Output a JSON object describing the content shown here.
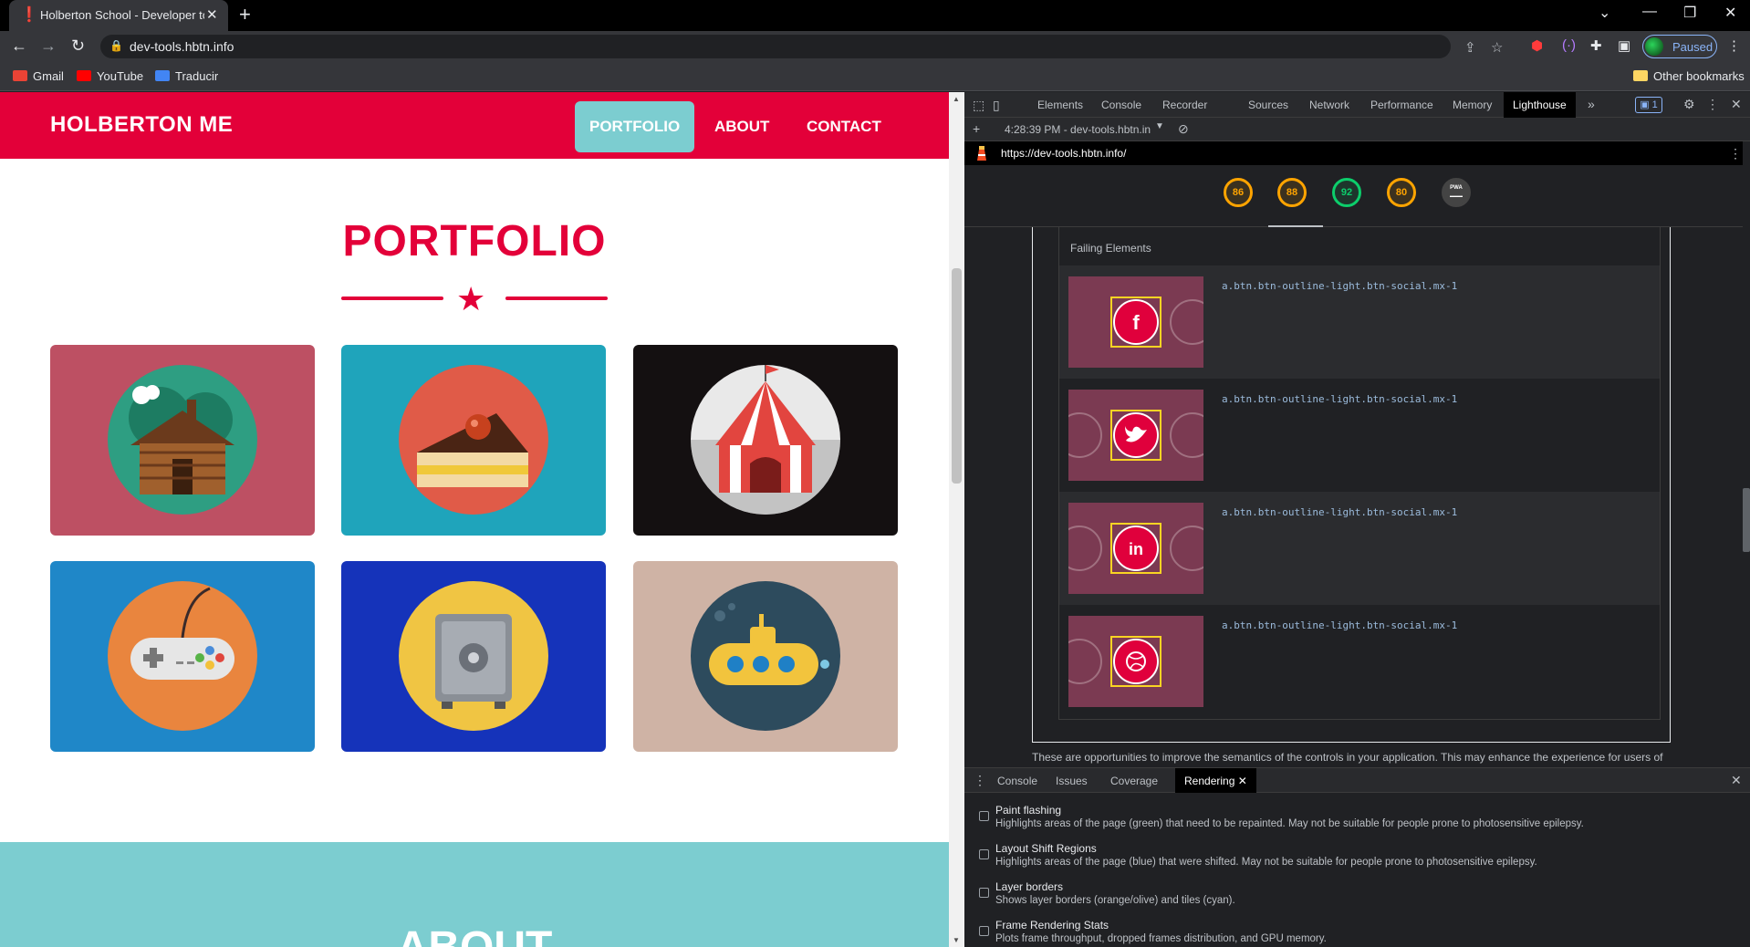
{
  "browser": {
    "tab_title": "Holberton School - Developer to",
    "url": "dev-tools.hbtn.info",
    "profile_status": "Paused",
    "bookmarks": [
      "Gmail",
      "YouTube",
      "Traducir"
    ],
    "other_bookmarks": "Other bookmarks"
  },
  "site": {
    "brand": "HOLBERTON ME",
    "nav": [
      "PORTFOLIO",
      "ABOUT",
      "CONTACT"
    ],
    "portfolio_title": "PORTFOLIO",
    "about_title": "ABOUT",
    "cards": [
      {
        "name": "cabin",
        "bg": "#bd5063"
      },
      {
        "name": "cake",
        "bg": "#1fa4bb"
      },
      {
        "name": "circus-tent",
        "bg": "#141011"
      },
      {
        "name": "game-controller",
        "bg": "#1f87c8"
      },
      {
        "name": "safe",
        "bg": "#1533ba"
      },
      {
        "name": "submarine",
        "bg": "#cfb3a5"
      }
    ]
  },
  "devtools": {
    "tabs": [
      "Elements",
      "Console",
      "Recorder",
      "Sources",
      "Network",
      "Performance",
      "Memory",
      "Lighthouse"
    ],
    "active_tab": "Lighthouse",
    "issues_count": "1",
    "report_time": "4:28:39 PM - dev-tools.hbtn.in",
    "report_url": "https://dev-tools.hbtn.info/",
    "scores": [
      "86",
      "88",
      "92",
      "80"
    ],
    "pwa_label": "PWA",
    "failing_elements_header": "Failing Elements",
    "failing_rows": [
      {
        "selector": "a.btn.btn-outline-light.btn-social.mx-1",
        "icon": "facebook"
      },
      {
        "selector": "a.btn.btn-outline-light.btn-social.mx-1",
        "icon": "twitter"
      },
      {
        "selector": "a.btn.btn-outline-light.btn-social.mx-1",
        "icon": "linkedin"
      },
      {
        "selector": "a.btn.btn-outline-light.btn-social.mx-1",
        "icon": "dribbble"
      }
    ],
    "truncated_description": "These are opportunities to improve the semantics of the controls in your application. This may enhance the experience for users of",
    "drawer_tabs": [
      "Console",
      "Issues",
      "Coverage",
      "Rendering"
    ],
    "active_drawer_tab": "Rendering",
    "rendering_options": [
      {
        "name": "Paint flashing",
        "desc": "Highlights areas of the page (green) that need to be repainted. May not be suitable for people prone to photosensitive epilepsy."
      },
      {
        "name": "Layout Shift Regions",
        "desc": "Highlights areas of the page (blue) that were shifted. May not be suitable for people prone to photosensitive epilepsy."
      },
      {
        "name": "Layer borders",
        "desc": "Shows layer borders (orange/olive) and tiles (cyan)."
      },
      {
        "name": "Frame Rendering Stats",
        "desc": "Plots frame throughput, dropped frames distribution, and GPU memory."
      }
    ]
  },
  "colors": {
    "brand_red": "#e30039",
    "active_nav_bg": "#7ccdd0",
    "score_orange": "#ffa400",
    "score_green": "#0cce6b"
  }
}
